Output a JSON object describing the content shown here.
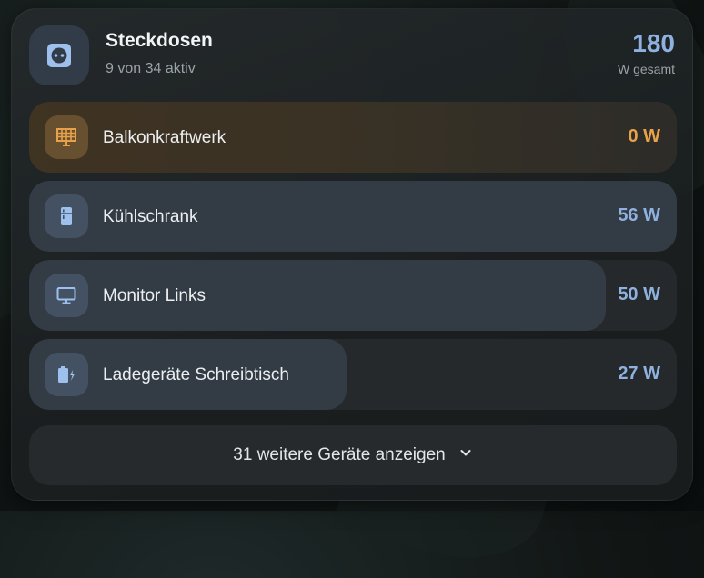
{
  "header": {
    "title": "Steckdosen",
    "subtitle": "9 von 34 aktiv",
    "total_value": "180",
    "total_unit": "W gesamt",
    "icon": "power-socket-icon"
  },
  "devices": [
    {
      "name": "Balkonkraftwerk",
      "power": "0 W",
      "icon": "solar-panel-icon",
      "load_fraction": 1.0,
      "color": "#e7a14a"
    },
    {
      "name": "Kühlschrank",
      "power": "56 W",
      "icon": "fridge-icon",
      "load_fraction": 1.0,
      "color": "#8fb1e0"
    },
    {
      "name": "Monitor Links",
      "power": "50 W",
      "icon": "monitor-icon",
      "load_fraction": 0.89,
      "color": "#8fb1e0"
    },
    {
      "name": "Ladegeräte Schreibtisch",
      "power": "27 W",
      "icon": "battery-charging-icon",
      "load_fraction": 0.49,
      "color": "#8fb1e0"
    }
  ],
  "show_more": {
    "label": "31 weitere Geräte anzeigen",
    "icon": "chevron-down-icon"
  },
  "colors": {
    "accent_blue": "#8fb1e0",
    "accent_orange": "#e7a14a"
  }
}
